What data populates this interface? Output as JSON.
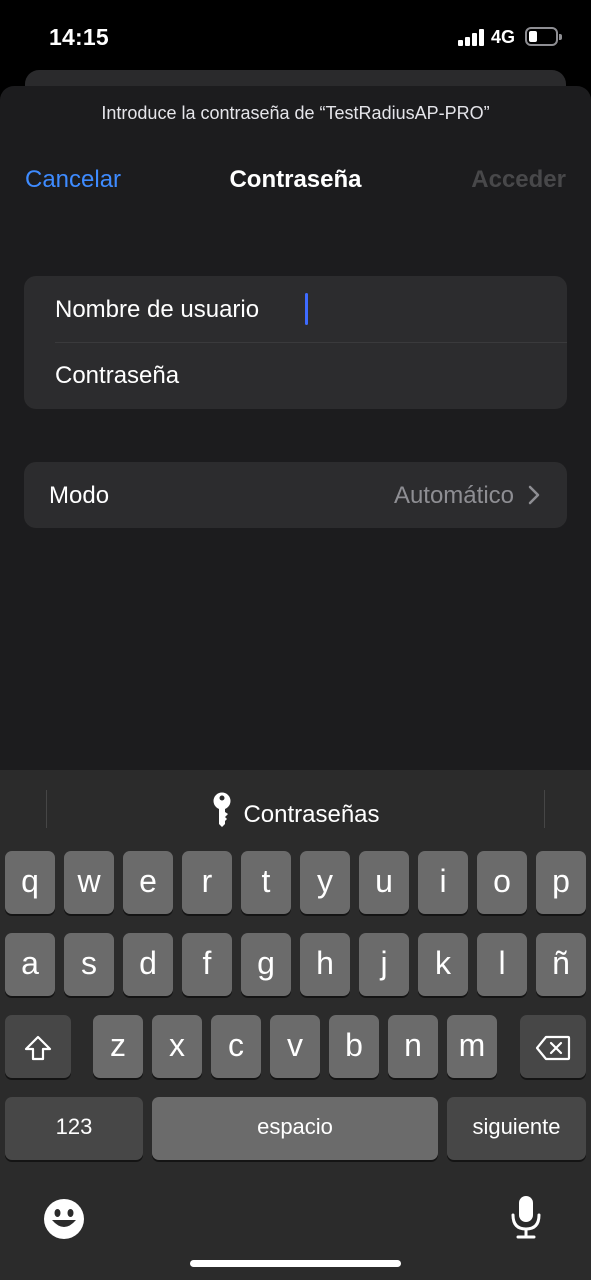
{
  "status": {
    "time": "14:15",
    "network": "4G"
  },
  "sheet": {
    "prompt": "Introduce la contraseña de “TestRadiusAP-PRO”",
    "cancel": "Cancelar",
    "title": "Contraseña",
    "action": "Acceder"
  },
  "fields": {
    "username_label": "Nombre de usuario",
    "password_label": "Contraseña"
  },
  "mode": {
    "label": "Modo",
    "value": "Automático"
  },
  "keyboard": {
    "suggestion": "Contraseñas",
    "row1": [
      "q",
      "w",
      "e",
      "r",
      "t",
      "y",
      "u",
      "i",
      "o",
      "p"
    ],
    "row2": [
      "a",
      "s",
      "d",
      "f",
      "g",
      "h",
      "j",
      "k",
      "l",
      "ñ"
    ],
    "row3": [
      "z",
      "x",
      "c",
      "v",
      "b",
      "n",
      "m"
    ],
    "numbers": "123",
    "space": "espacio",
    "next": "siguiente"
  },
  "colors": {
    "accent": "#3e8bff",
    "disabled": "#48484a",
    "key": "#6b6b6b",
    "key_dark": "#474747"
  }
}
